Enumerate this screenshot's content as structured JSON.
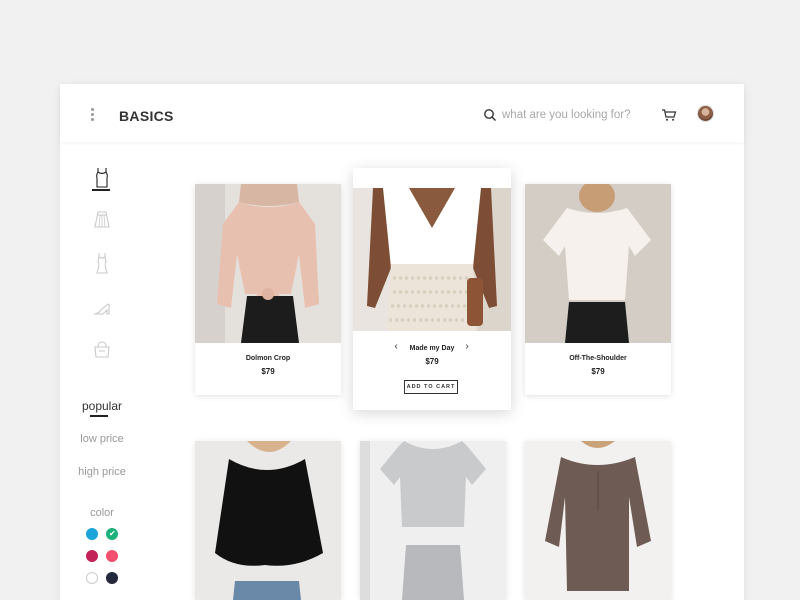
{
  "header": {
    "brand": "BASICS",
    "search_placeholder": "what are you looking for?"
  },
  "sidebar": {
    "categories": [
      {
        "name": "tops",
        "icon": "tank-top-icon",
        "active": true
      },
      {
        "name": "skirts",
        "icon": "skirt-icon",
        "active": false
      },
      {
        "name": "dresses",
        "icon": "dress-icon",
        "active": false
      },
      {
        "name": "shoes",
        "icon": "heel-shoe-icon",
        "active": false
      },
      {
        "name": "bags",
        "icon": "handbag-icon",
        "active": false
      }
    ],
    "sort_options": [
      {
        "label": "popular",
        "active": true
      },
      {
        "label": "low price",
        "active": false
      },
      {
        "label": "high price",
        "active": false
      }
    ],
    "color_label": "color",
    "colors": [
      {
        "hex": "#1ba5d9",
        "selected": false
      },
      {
        "hex": "#1cb07a",
        "selected": true
      },
      {
        "hex": "#c2245a",
        "selected": false
      },
      {
        "hex": "#f0506e",
        "selected": false
      },
      {
        "hex": "#ffffff",
        "selected": false
      },
      {
        "hex": "#23283a",
        "selected": false
      }
    ]
  },
  "products": [
    {
      "name": "Dolmon Crop",
      "price": "$79"
    },
    {
      "name": "Made my Day",
      "price": "$79",
      "button": "ADD TO CART"
    },
    {
      "name": "Off-The-Shoulder",
      "price": "$79"
    },
    {
      "name": "",
      "price": ""
    },
    {
      "name": "",
      "price": ""
    },
    {
      "name": "",
      "price": ""
    }
  ],
  "carousel": {
    "prev": "‹",
    "next": "›"
  }
}
